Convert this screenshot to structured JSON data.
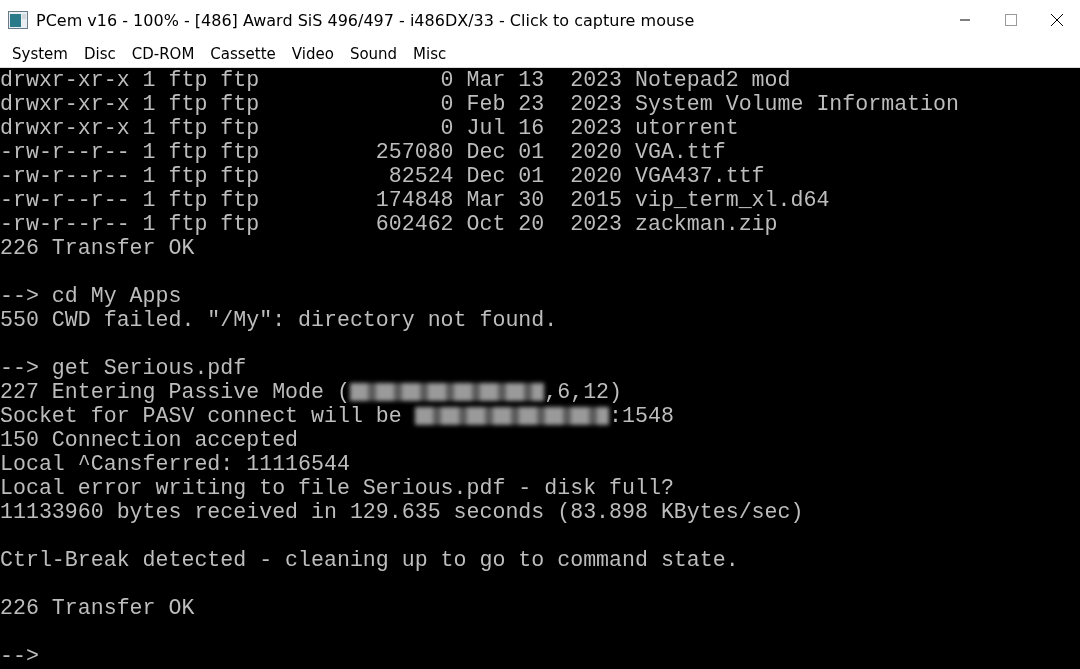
{
  "window": {
    "title": "PCem v16 - 100% - [486] Award SiS 496/497 - i486DX/33 - Click to capture mouse"
  },
  "menu": [
    {
      "label": "System"
    },
    {
      "label": "Disc"
    },
    {
      "label": "CD-ROM"
    },
    {
      "label": "Cassette"
    },
    {
      "label": "Video"
    },
    {
      "label": "Sound"
    },
    {
      "label": "Misc"
    }
  ],
  "terminal": {
    "lines": [
      {
        "kind": "text",
        "text": "drwxr-xr-x 1 ftp ftp              0 Mar 13  2023 Notepad2 mod"
      },
      {
        "kind": "text",
        "text": "drwxr-xr-x 1 ftp ftp              0 Feb 23  2023 System Volume Information"
      },
      {
        "kind": "text",
        "text": "drwxr-xr-x 1 ftp ftp              0 Jul 16  2023 utorrent"
      },
      {
        "kind": "text",
        "text": "-rw-r--r-- 1 ftp ftp         257080 Dec 01  2020 VGA.ttf"
      },
      {
        "kind": "text",
        "text": "-rw-r--r-- 1 ftp ftp          82524 Dec 01  2020 VGA437.ttf"
      },
      {
        "kind": "text",
        "text": "-rw-r--r-- 1 ftp ftp         174848 Mar 30  2015 vip_term_xl.d64"
      },
      {
        "kind": "text",
        "text": "-rw-r--r-- 1 ftp ftp         602462 Oct 20  2023 zackman.zip"
      },
      {
        "kind": "text",
        "text": "226 Transfer OK"
      },
      {
        "kind": "blank"
      },
      {
        "kind": "text",
        "text": "--> cd My Apps"
      },
      {
        "kind": "text",
        "text": "550 CWD failed. \"/My\": directory not found."
      },
      {
        "kind": "blank"
      },
      {
        "kind": "text",
        "text": "--> get Serious.pdf"
      },
      {
        "kind": "mixed",
        "parts": [
          {
            "kind": "text",
            "text": "227 Entering Passive Mode ("
          },
          {
            "kind": "redacted"
          },
          {
            "kind": "text",
            "text": ",6,12)"
          }
        ]
      },
      {
        "kind": "mixed",
        "parts": [
          {
            "kind": "text",
            "text": "Socket for PASV connect will be "
          },
          {
            "kind": "redacted"
          },
          {
            "kind": "text",
            "text": ":1548"
          }
        ]
      },
      {
        "kind": "text",
        "text": "150 Connection accepted"
      },
      {
        "kind": "text",
        "text": "Local ^Cansferred: 11116544"
      },
      {
        "kind": "text",
        "text": "Local error writing to file Serious.pdf - disk full?"
      },
      {
        "kind": "text",
        "text": "11133960 bytes received in 129.635 seconds (83.898 KBytes/sec)"
      },
      {
        "kind": "blank"
      },
      {
        "kind": "text",
        "text": "Ctrl-Break detected - cleaning up to go to command state."
      },
      {
        "kind": "blank"
      },
      {
        "kind": "text",
        "text": "226 Transfer OK"
      },
      {
        "kind": "blank"
      },
      {
        "kind": "text",
        "text": "-->"
      }
    ]
  }
}
